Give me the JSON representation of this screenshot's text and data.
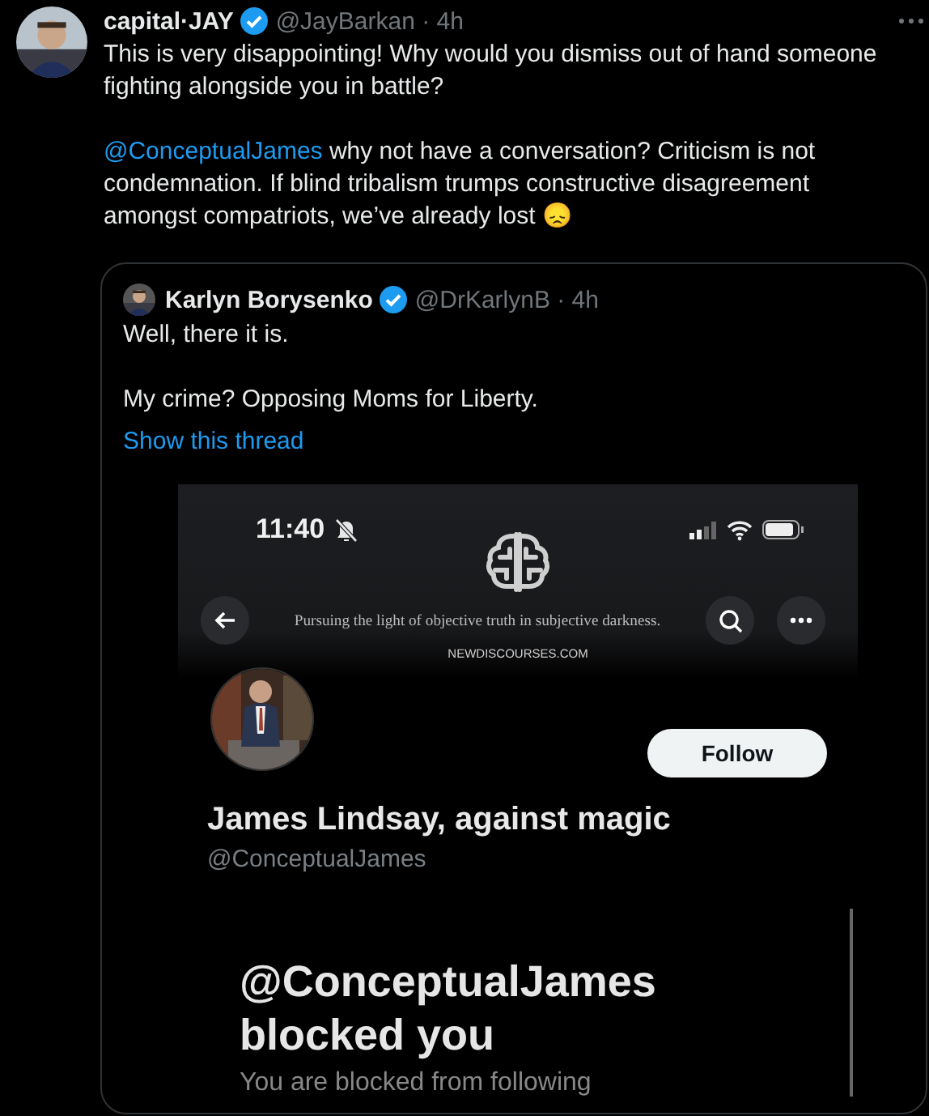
{
  "tweet": {
    "author": "capital·JAY",
    "verified": true,
    "meta": "@JayBarkan · 4h",
    "paragraphs": [
      {
        "text": "This is very disappointing! Why would you dismiss out of hand someone fighting alongside you in battle?"
      },
      {
        "mention": "@ConceptualJames",
        "text": " why not have a conversation? Criticism is not condemnation. If blind tribalism trumps constructive disagreement amongst compatriots, we’ve already lost 😞"
      }
    ]
  },
  "quote": {
    "author": "Karlyn Borysenko",
    "verified": true,
    "meta": "@DrKarlynB · 4h",
    "paragraphs": [
      "Well, there it is.",
      "My crime? Opposing Moms for Liberty."
    ],
    "thread_link": "Show this thread"
  },
  "screenshot": {
    "status_time": "11:40",
    "tagline": "Pursuing the light of objective truth in subjective darkness.",
    "site": "NEWDISCOURSES.COM",
    "follow_button": "Follow",
    "profile_name": "James Lindsay, against magic",
    "profile_handle": "@ConceptualJames",
    "blocked_title": "@ConceptualJames blocked you",
    "blocked_text": "You are blocked from following"
  }
}
